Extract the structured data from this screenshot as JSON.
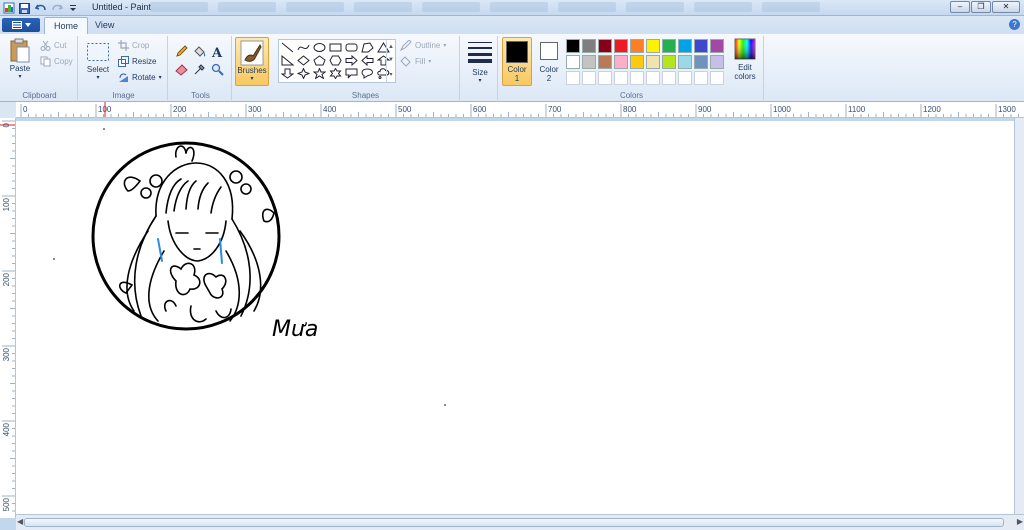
{
  "window": {
    "title": "Untitled - Paint"
  },
  "tabs": [
    {
      "label": "Home"
    },
    {
      "label": "View"
    }
  ],
  "clipboard": {
    "group_label": "Clipboard",
    "paste": "Paste",
    "cut": "Cut",
    "copy": "Copy"
  },
  "image": {
    "group_label": "Image",
    "select": "Select",
    "crop": "Crop",
    "resize": "Resize",
    "rotate": "Rotate"
  },
  "tools": {
    "group_label": "Tools"
  },
  "brushes": {
    "label": "Brushes"
  },
  "shapes": {
    "group_label": "Shapes",
    "outline": "Outline",
    "fill": "Fill"
  },
  "size": {
    "label": "Size"
  },
  "colors": {
    "group_label": "Colors",
    "color1": {
      "label": "Color",
      "num": "1",
      "value": "#000000"
    },
    "color2": {
      "label": "Color",
      "num": "2",
      "value": "#ffffff"
    },
    "edit_colors": {
      "line1": "Edit",
      "line2": "colors"
    },
    "palette": [
      "#000000",
      "#7f7f7f",
      "#880015",
      "#ed1c24",
      "#ff7f27",
      "#fff200",
      "#22b14c",
      "#00a2e8",
      "#3f48cc",
      "#a349a4",
      "#ffffff",
      "#c3c3c3",
      "#b97a57",
      "#ffaec9",
      "#ffc90e",
      "#efe4b0",
      "#b5e61d",
      "#99d9ea",
      "#7092be",
      "#c8bfe7",
      "#ffffff",
      "#ffffff",
      "#ffffff",
      "#ffffff",
      "#ffffff",
      "#ffffff",
      "#ffffff",
      "#ffffff",
      "#ffffff",
      "#ffffff"
    ]
  },
  "ruler": {
    "h_ticks": [
      "0",
      "100",
      "200",
      "300",
      "400",
      "500",
      "600",
      "700",
      "800",
      "900",
      "1000",
      "1100",
      "1200",
      "1300"
    ],
    "v_ticks": [
      "0",
      "100",
      "200",
      "300",
      "400",
      "500"
    ]
  },
  "canvas": {
    "signature": "Mưa"
  }
}
